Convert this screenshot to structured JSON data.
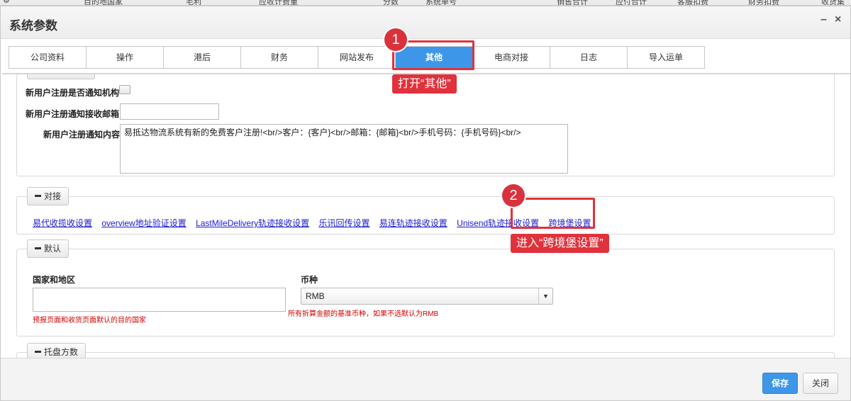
{
  "background_row": {
    "cells": [
      "目的地国家",
      "毛利",
      "应收计费重",
      "分数",
      "系统单号",
      "销售合计",
      "应付合计",
      "客服扣费",
      "财务扣费",
      "收货集"
    ]
  },
  "dialog": {
    "title": "系统参数",
    "minimize_label": "–",
    "close_label": "×"
  },
  "tabs": [
    {
      "label": "公司资料",
      "active": false
    },
    {
      "label": "操作",
      "active": false
    },
    {
      "label": "港后",
      "active": false
    },
    {
      "label": "财务",
      "active": false
    },
    {
      "label": "网站发布",
      "active": false
    },
    {
      "label": "其他",
      "active": true
    },
    {
      "label": "电商对接",
      "active": false
    },
    {
      "label": "日志",
      "active": false
    },
    {
      "label": "导入运单",
      "active": false
    }
  ],
  "registration": {
    "notify_org_label": "新用户注册是否通知机构",
    "notify_email_label": "新用户注册通知接收邮箱",
    "notify_email_value": "",
    "notify_content_label": "新用户注册通知内容",
    "notify_content_value": "易抵达物流系统有新的免费客户注册!<br/>客户：{客户}<br/>邮箱：{邮箱}<br/>手机号码：{手机号码}<br/>"
  },
  "integration": {
    "legend": "对接",
    "links": [
      "易代收揽收设置",
      "overview地址验证设置",
      "LastMileDelivery轨迹接收设置",
      "乐讯回传设置",
      "易连轨迹接收设置",
      "Unisend轨迹接收设置",
      "跨境堡设置"
    ]
  },
  "defaults": {
    "legend": "默认",
    "country_label": "国家和地区",
    "country_value": "",
    "country_hint": "预报页面和收货页面默认的目的国家",
    "currency_label": "币种",
    "currency_value": "RMB",
    "currency_hint": "所有折算金额的基准币种，如果不选默认为RMB"
  },
  "pallet": {
    "legend": "托盘方数"
  },
  "footer": {
    "save_label": "保存",
    "close_label": "关闭"
  },
  "annotations": {
    "step1_number": "1",
    "step1_text": "打开“其他”",
    "step2_number": "2",
    "step2_text": "进入“跨境堡设置”",
    "color": "#e0323c"
  },
  "colors": {
    "accent": "#3d96e8",
    "link": "#1a1ad4",
    "hint": "#d40000"
  }
}
